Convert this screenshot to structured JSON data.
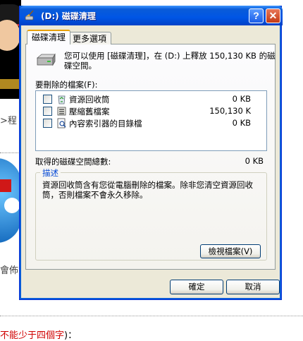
{
  "background": {
    "text_program": ">程",
    "text_will": "會佈",
    "text_bottom_red": "不能少于四個字",
    "text_bottom_black": ")："
  },
  "dialog": {
    "title": "(D:) 磁碟清理",
    "help_glyph": "?",
    "close_glyph": "✕",
    "tabs": [
      {
        "label": "磁碟清理",
        "active": true
      },
      {
        "label": "更多選項",
        "active": false
      }
    ],
    "description": "您可以使用 [磁碟清理]，在 (D:) 上釋放 150,130 KB 的磁碟空間。",
    "files_label": "要刪除的檔案(F):",
    "files": [
      {
        "name": "資源回收筒",
        "size": "0 KB",
        "checked": false,
        "icon": "recycle-bin-icon"
      },
      {
        "name": "壓縮舊檔案",
        "size": "150,130 K",
        "checked": false,
        "icon": "compress-icon"
      },
      {
        "name": "內容索引器的目錄檔",
        "size": "0 KB",
        "checked": false,
        "icon": "index-catalog-icon"
      }
    ],
    "total_label": "取得的磁碟空間總數:",
    "total_value": "0 KB",
    "group_title": "描述",
    "group_description": "資源回收筒含有您從電腦刪除的檔案。除非您清空資源回收筒，否則檔案不會永久移除。",
    "view_files_label": "檢視檔案(V)",
    "ok_label": "確定",
    "cancel_label": "取消",
    "colors": {
      "titlebar": "#0055e5",
      "face": "#ece9d8",
      "group_title": "#0046d5",
      "accent_tab": "#e8a000"
    }
  }
}
